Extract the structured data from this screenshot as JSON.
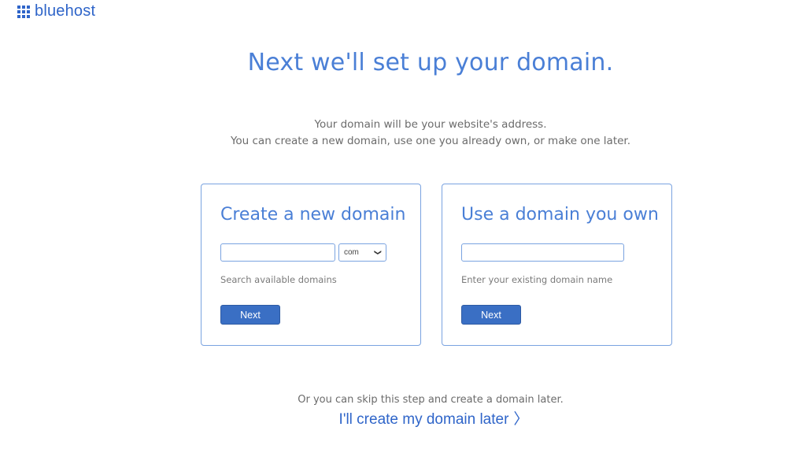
{
  "brand": {
    "name": "bluehost",
    "color": "#2f65c9"
  },
  "heading": {
    "title": "Next we'll set up your domain.",
    "subtitle_line1": "Your domain will be your website's address.",
    "subtitle_line2": "You can create a new domain, use one you already own, or make one later."
  },
  "create_card": {
    "title": "Create a new domain",
    "input_value": "",
    "tld_selected": "com",
    "hint": "Search available domains",
    "button_label": "Next"
  },
  "own_card": {
    "title": "Use a domain you own",
    "input_value": "",
    "hint": "Enter your existing domain name",
    "button_label": "Next"
  },
  "skip": {
    "text": "Or you can skip this step and create a domain later.",
    "link_label": "I'll create my domain later"
  },
  "colors": {
    "accent": "#4a7fd6",
    "button": "#3a6fc4",
    "border": "#7aa3e0"
  }
}
